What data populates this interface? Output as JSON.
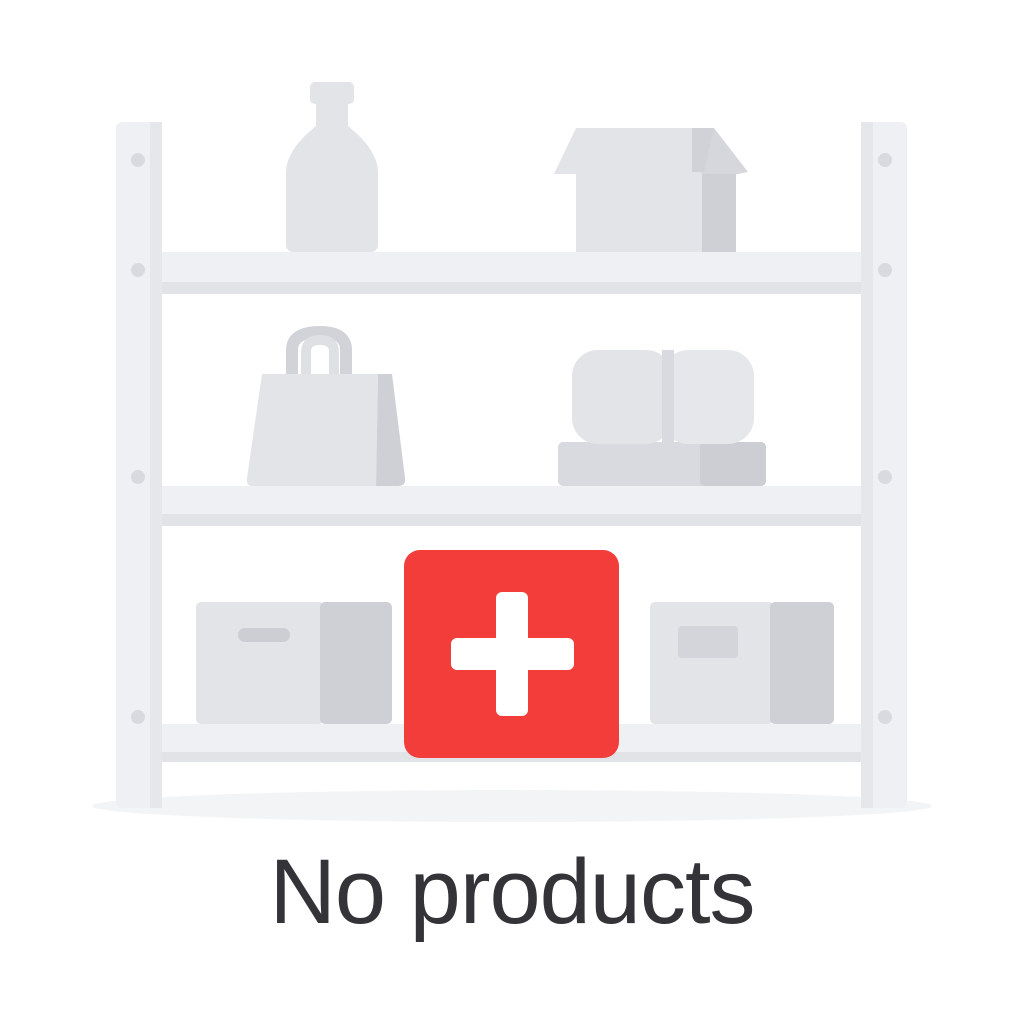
{
  "empty_state": {
    "title": "No products"
  },
  "icons": {
    "shelf": "shelf-icon",
    "bottle": "bottle-icon",
    "box": "box-icon",
    "bag": "shopping-bag-icon",
    "bundle": "bundle-icon",
    "add": "plus-icon"
  },
  "colors": {
    "accent": "#F23D3A",
    "shelf_light": "#EFF0F3",
    "shelf_mid": "#E4E5E9",
    "product_light": "#E3E4E8",
    "product_dark": "#CDCED3",
    "text": "#333338",
    "icon_fg": "#FFFFFF"
  }
}
